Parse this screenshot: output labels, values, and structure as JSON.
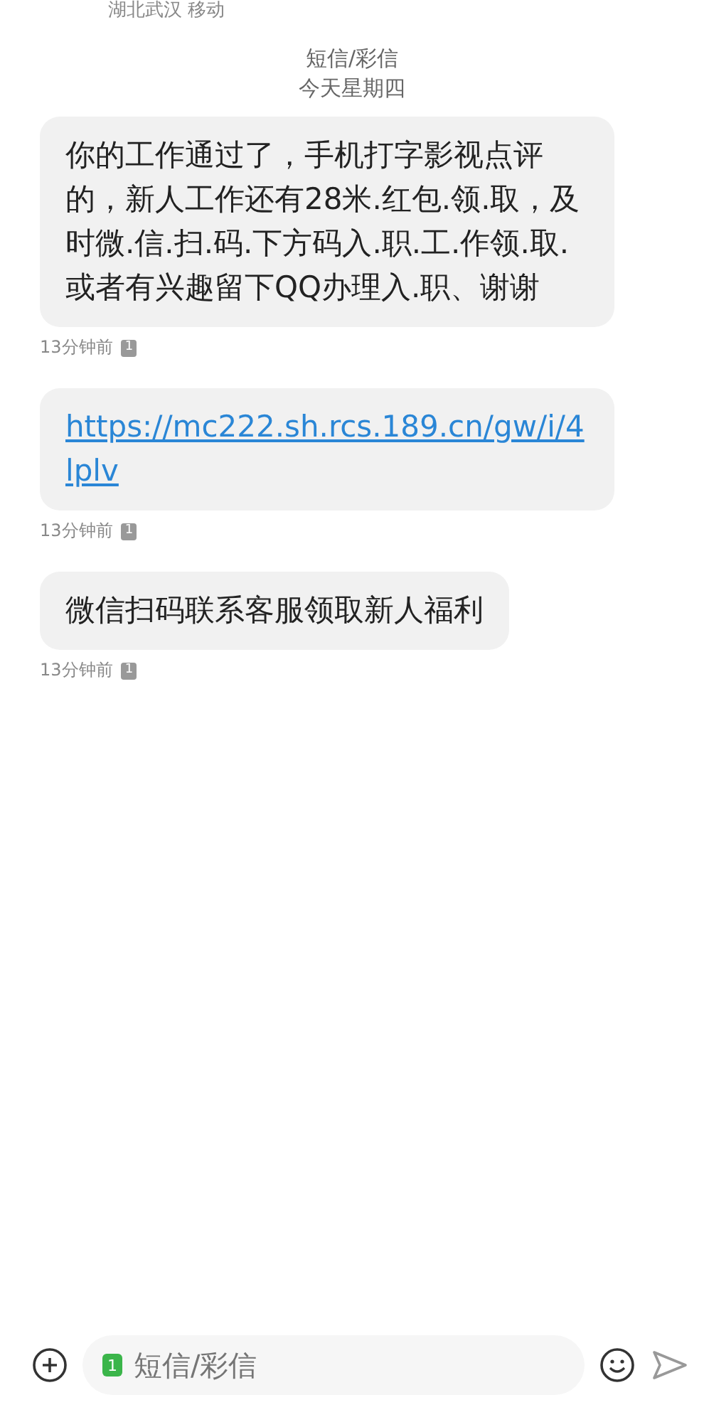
{
  "sender": {
    "subtitle": "湖北武汉 移动"
  },
  "thread": {
    "channel": "短信/彩信",
    "date": "今天星期四"
  },
  "messages": [
    {
      "kind": "text",
      "text": "你的工作通过了，手机打字影视点评的，新人工作还有28米.红包.领.取，及时微.信.扫.码.下方码入.职.工.作领.取.或者有兴趣留下QQ办理入.职、谢谢",
      "time": "13分钟前",
      "sim": "1"
    },
    {
      "kind": "link",
      "text": "https://mc222.sh.rcs.189.cn/gw/i/4lplv",
      "time": "13分钟前",
      "sim": "1"
    },
    {
      "kind": "text",
      "text": "微信扫码联系客服领取新人福利",
      "time": "13分钟前",
      "sim": "1"
    }
  ],
  "composer": {
    "placeholder": "短信/彩信",
    "sim": "1"
  }
}
